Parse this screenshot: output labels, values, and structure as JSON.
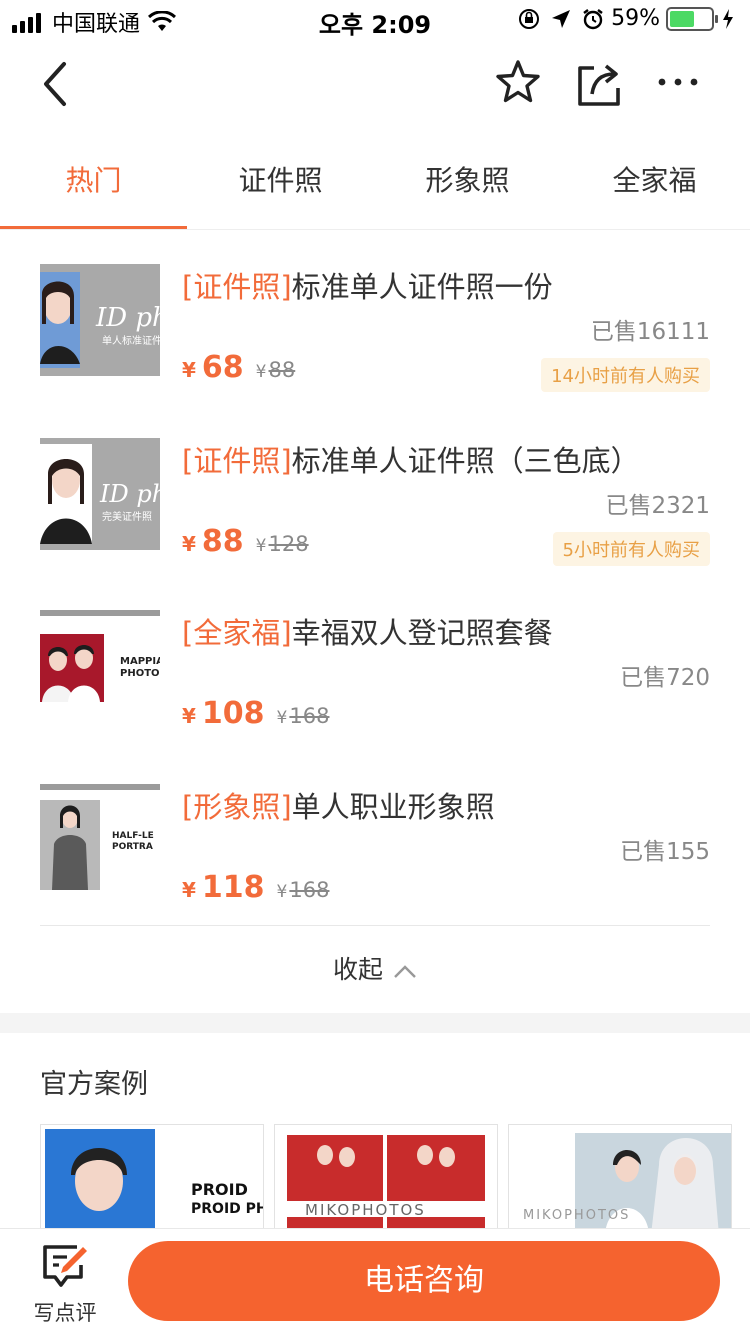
{
  "status_bar": {
    "carrier": "中国联通",
    "time": "오후 2:09",
    "battery": "59%",
    "battery_level": 0.59
  },
  "nav": {
    "back_icon": "chevron-left-icon",
    "favorite_icon": "star-icon",
    "share_icon": "share-icon",
    "more_icon": "more-icon"
  },
  "tabs": [
    {
      "label": "热门",
      "active": true
    },
    {
      "label": "证件照",
      "active": false
    },
    {
      "label": "形象照",
      "active": false
    },
    {
      "label": "全家福",
      "active": false
    }
  ],
  "products": [
    {
      "tag": "[证件照]",
      "name": "标准单人证件照一份",
      "sold": "已售16111",
      "currency": "¥",
      "price": "68",
      "original_price": "88",
      "recent": "14小时前有人购买",
      "thumb_text": "单人标准证件"
    },
    {
      "tag": "[证件照]",
      "name": "标准单人证件照（三色底）",
      "sold": "已售2321",
      "currency": "¥",
      "price": "88",
      "original_price": "128",
      "recent": "5小时前有人购买",
      "thumb_text": "完美证件照"
    },
    {
      "tag": "[全家福]",
      "name": "幸福双人登记照套餐",
      "sold": "已售720",
      "currency": "¥",
      "price": "108",
      "original_price": "168",
      "thumb_text": "MAPPIA PHOTO"
    },
    {
      "tag": "[形象照]",
      "name": "单人职业形象照",
      "sold": "已售155",
      "currency": "¥",
      "price": "118",
      "original_price": "168",
      "thumb_text": "HALF-LE PORTRA"
    }
  ],
  "collapse_label": "收起",
  "cases": {
    "title": "官方案例",
    "items": [
      {
        "text": "PROID PHOTO 证件照"
      },
      {
        "text": "MIKOPHOTOS"
      },
      {
        "text": "MIKOPHOTOS"
      }
    ]
  },
  "bottom_bar": {
    "review_label": "写点评",
    "call_label": "电话咨询"
  },
  "colors": {
    "accent": "#f26b3a",
    "recent_bg": "#fdf4e3",
    "recent_text": "#e8a046",
    "button": "#f5632f"
  }
}
